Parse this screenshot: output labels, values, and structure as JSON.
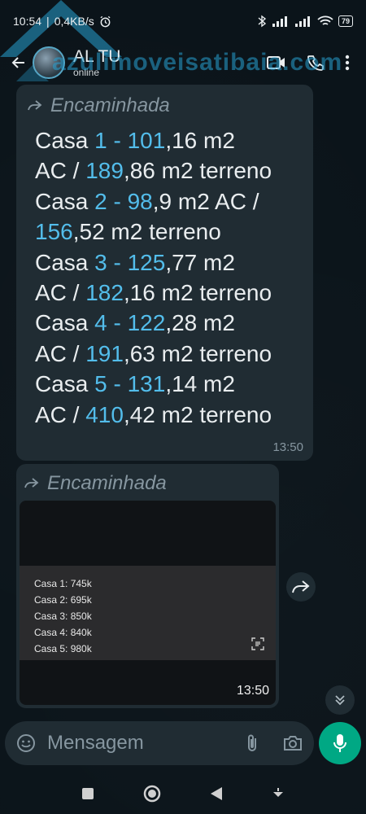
{
  "status_bar": {
    "time": "10:54",
    "speed": "0,4KB/s",
    "battery": "79"
  },
  "header": {
    "contact_name": "AL TU",
    "status": "online"
  },
  "watermark": "azulimoveisatibaia.com",
  "message1": {
    "forwarded_label": "Encaminhada",
    "lines": [
      [
        {
          "t": "Casa ",
          "c": "n"
        },
        {
          "t": "1 - 101",
          "c": "h"
        },
        {
          "t": ",16 m2",
          "c": "n"
        }
      ],
      [
        {
          "t": "AC / ",
          "c": "n"
        },
        {
          "t": "189",
          "c": "h"
        },
        {
          "t": ",86 m2 terreno",
          "c": "n"
        }
      ],
      [
        {
          "t": "Casa ",
          "c": "n"
        },
        {
          "t": "2 - 98",
          "c": "h"
        },
        {
          "t": ",9 m2 AC /",
          "c": "n"
        }
      ],
      [
        {
          "t": "156",
          "c": "h"
        },
        {
          "t": ",52 m2 terreno",
          "c": "n"
        }
      ],
      [
        {
          "t": "Casa ",
          "c": "n"
        },
        {
          "t": "3 - 125",
          "c": "h"
        },
        {
          "t": ",77 m2",
          "c": "n"
        }
      ],
      [
        {
          "t": "AC / ",
          "c": "n"
        },
        {
          "t": "182",
          "c": "h"
        },
        {
          "t": ",16 m2 terreno",
          "c": "n"
        }
      ],
      [
        {
          "t": "Casa ",
          "c": "n"
        },
        {
          "t": "4 - 122",
          "c": "h"
        },
        {
          "t": ",28 m2",
          "c": "n"
        }
      ],
      [
        {
          "t": "AC / ",
          "c": "n"
        },
        {
          "t": "191",
          "c": "h"
        },
        {
          "t": ",63 m2 terreno",
          "c": "n"
        }
      ],
      [
        {
          "t": "Casa ",
          "c": "n"
        },
        {
          "t": "5 - 131",
          "c": "h"
        },
        {
          "t": ",14 m2",
          "c": "n"
        }
      ],
      [
        {
          "t": "AC / ",
          "c": "n"
        },
        {
          "t": "410",
          "c": "h"
        },
        {
          "t": ",42 m2 terreno",
          "c": "n"
        }
      ]
    ],
    "time": "13:50"
  },
  "message2": {
    "forwarded_label": "Encaminhada",
    "prices": [
      "Casa 1: 745k",
      "Casa 2: 695k",
      "Casa 3: 850k",
      "Casa 4: 840k",
      "Casa 5: 980k"
    ],
    "time": "13:50"
  },
  "input": {
    "placeholder": "Mensagem"
  },
  "colors": {
    "accent": "#00a884",
    "highlight": "#53bdeb",
    "bubble": "#202c33"
  }
}
